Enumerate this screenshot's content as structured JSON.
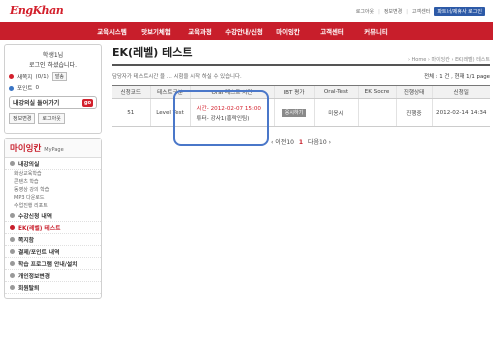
{
  "logo": {
    "main": "EngKhan"
  },
  "utility": {
    "links": [
      "로그아웃",
      "정보변경",
      "고객센터"
    ],
    "partner": "파트너/제휴사 로그인"
  },
  "nav": [
    "교육시스템",
    "맛보기체험",
    "교육과정",
    "수강안내/신청",
    "마이잉칸",
    "고객센터",
    "커뮤니티"
  ],
  "login": {
    "greet1": "학생1님",
    "greet2": "로그인 하셨습니다.",
    "message_label": "새쪽지",
    "message_count": "(0/1)",
    "message_btn": "발송",
    "point_label": "포인트",
    "point_value": "0",
    "continue_label": "내강의실 들어가기",
    "go": "go",
    "info_btn": "정보변경",
    "logout_btn": "로그아웃"
  },
  "mypage": {
    "title": "마이잉칸",
    "subtitle": "MyPage",
    "items": [
      {
        "label": "내강의실",
        "subs": [
          "화상교육학습",
          "콘텐츠 학습",
          "동영상 강의 학습",
          "MP3 다운로드",
          "수업진행 리포트"
        ]
      },
      {
        "label": "수강신청 내역"
      },
      {
        "label": "EK(레벨) 테스트",
        "active": true
      },
      {
        "label": "쪽지함"
      },
      {
        "label": "결제/포인트 내역"
      },
      {
        "label": "학습 프로그램 안내/설치"
      },
      {
        "label": "개인정보변경"
      },
      {
        "label": "회원탈퇴"
      }
    ]
  },
  "main": {
    "title": "EK(레벨) 테스트",
    "breadcrumb": "› Home › 마이잉칸 › EK(레벨) 테스트",
    "notice": "담당자가 테스트시간 을 ... 시험을 시작 하실 수 있습니다.",
    "total": "전체 : 1 건 , 현재 1/1 page"
  },
  "table": {
    "headers": [
      "신청코드",
      "테스트구분",
      "Oral 테스트 시간",
      "IBT 평가",
      "Oral-Test",
      "EK Socre",
      "진행상태",
      "신청일"
    ],
    "rows": [
      {
        "code": "51",
        "type": "Level Test",
        "oral_time": "시간- 2012-02-07 15:00",
        "oral_tutor": "튜터- 강사1(홍락인팀)",
        "ibt": "응시하기",
        "oral_test": "미응시",
        "ek_score": "",
        "status": "진행중",
        "date": "2012-02-14 14:34"
      }
    ]
  },
  "pager": {
    "prev": "‹ 이전10",
    "current": "1",
    "next": "다음10 ›"
  }
}
